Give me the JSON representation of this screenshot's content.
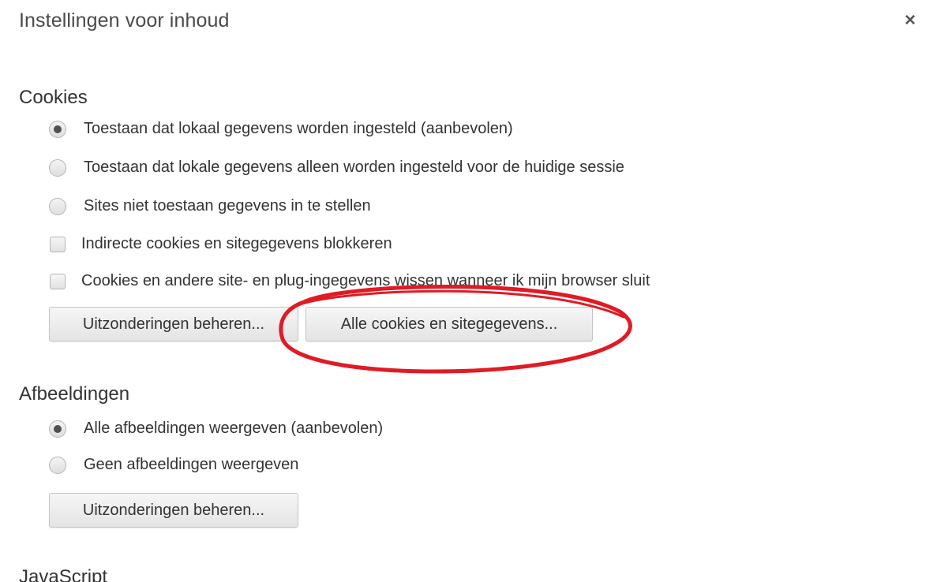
{
  "dialog": {
    "title": "Instellingen voor inhoud",
    "close_glyph": "×"
  },
  "cookies": {
    "heading": "Cookies",
    "radio_options": [
      {
        "label": "Toestaan dat lokaal gegevens worden ingesteld (aanbevolen)",
        "checked": true
      },
      {
        "label": "Toestaan dat lokale gegevens alleen worden ingesteld voor de huidige sessie",
        "checked": false
      },
      {
        "label": "Sites niet toestaan gegevens in te stellen",
        "checked": false
      }
    ],
    "checkbox_options": [
      {
        "label": "Indirecte cookies en sitegegevens blokkeren",
        "checked": false
      },
      {
        "label": "Cookies en andere site- en plug-ingegevens wissen wanneer ik mijn browser sluit",
        "checked": false
      }
    ],
    "buttons": {
      "exceptions_label": "Uitzonderingen beheren...",
      "all_cookies_label": "Alle cookies en sitegegevens..."
    }
  },
  "images": {
    "heading": "Afbeeldingen",
    "radio_options": [
      {
        "label": "Alle afbeeldingen weergeven (aanbevolen)",
        "checked": true
      },
      {
        "label": "Geen afbeeldingen weergeven",
        "checked": false
      }
    ],
    "buttons": {
      "exceptions_label": "Uitzonderingen beheren..."
    }
  },
  "javascript": {
    "heading": "JavaScript"
  },
  "annotation": {
    "color": "#e01b24",
    "icon": "red-ellipse-highlight"
  },
  "colors": {
    "text": "#333333",
    "button_border": "#c4c4c4"
  }
}
